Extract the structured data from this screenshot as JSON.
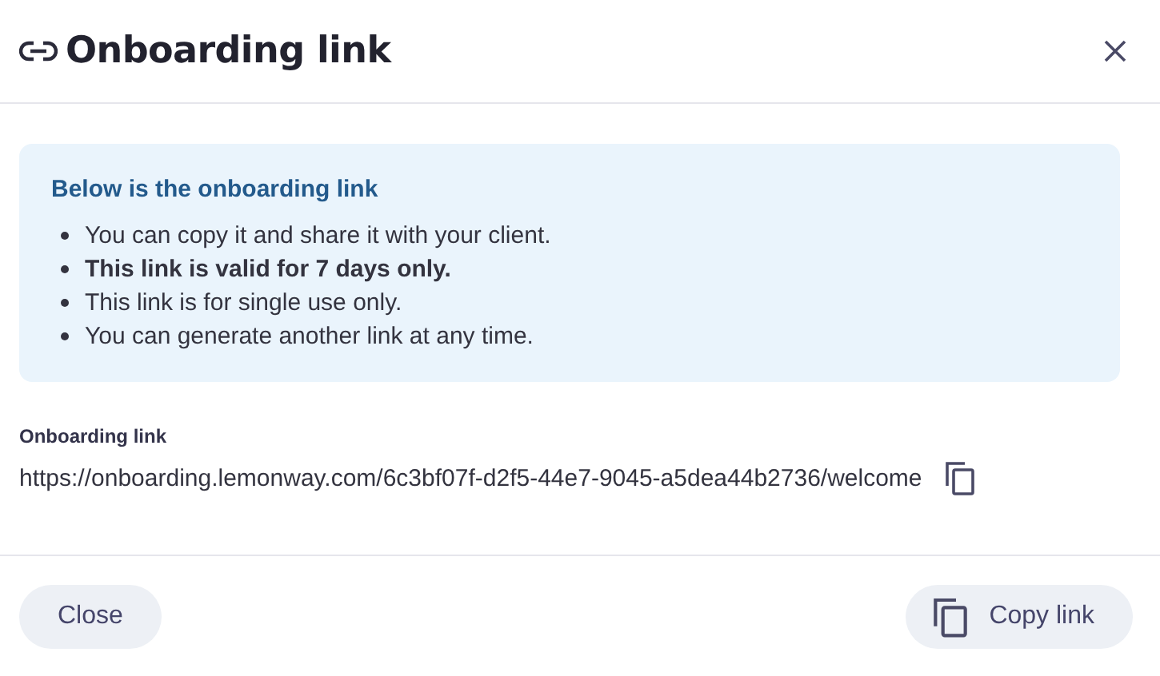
{
  "dialog": {
    "title": "Onboarding link"
  },
  "notice": {
    "heading": "Below is the onboarding link",
    "items": [
      {
        "text": "You can copy it and share it with your client.",
        "emphasized": false
      },
      {
        "text": "This link is valid for 7 days only.",
        "emphasized": true
      },
      {
        "text": "This link is for single use only.",
        "emphasized": false
      },
      {
        "text": "You can generate another link at any time.",
        "emphasized": false
      }
    ]
  },
  "link_field": {
    "label": "Onboarding link",
    "value": "https://onboarding.lemonway.com/6c3bf07f-d2f5-44e7-9045-a5dea44b2736/welcome"
  },
  "buttons": {
    "close": "Close",
    "copy": "Copy link"
  }
}
